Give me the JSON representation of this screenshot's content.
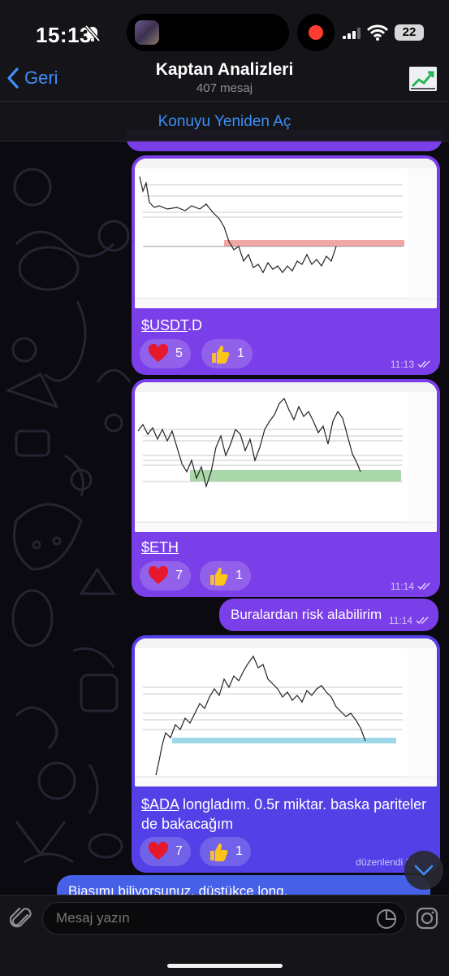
{
  "status_bar": {
    "time": "15:13",
    "battery": "22"
  },
  "header": {
    "back_label": "Geri",
    "title": "Kaptan Analizleri",
    "subtitle": "407 mesaj",
    "reopen_label": "Konuyu Yeniden Aç"
  },
  "messages": [
    {
      "ticker": "$USDT",
      "caption_rest": ".D",
      "reactions": [
        {
          "icon": "heart",
          "count": "5"
        },
        {
          "icon": "thumbs-up",
          "count": "1"
        }
      ],
      "time": "11:13"
    },
    {
      "ticker": "$ETH",
      "caption_rest": "",
      "reactions": [
        {
          "icon": "heart",
          "count": "7"
        },
        {
          "icon": "thumbs-up",
          "count": "1"
        }
      ],
      "time": "11:14"
    },
    {
      "text": "Buralardan risk alabilirim",
      "time": "11:14"
    },
    {
      "ticker": "$ADA",
      "caption_rest": " longladım. 0.5r miktar. baska pariteler de bakacağım",
      "reactions": [
        {
          "icon": "heart",
          "count": "7"
        },
        {
          "icon": "thumbs-up",
          "count": "1"
        }
      ],
      "time": "düzenlendi 11"
    },
    {
      "text": "Biasımı biliyorsunuz, düstükce long."
    }
  ],
  "input": {
    "placeholder": "Mesaj yazın"
  },
  "colors": {
    "accent": "#3e8ef7",
    "bubble_purple": "#7a3fe8",
    "bubble_blue": "#5340e6"
  }
}
